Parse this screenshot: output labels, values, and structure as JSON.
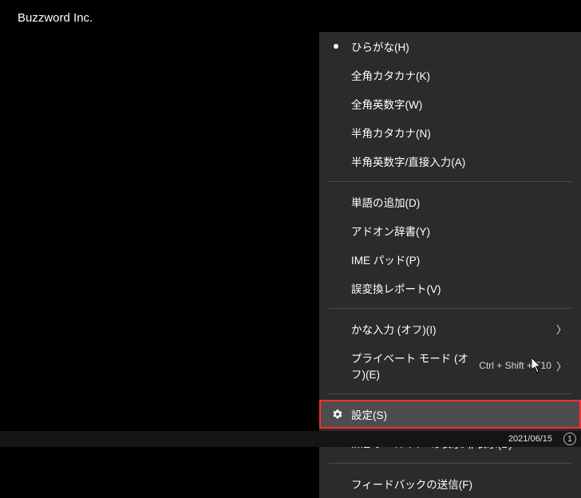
{
  "title": "Buzzword Inc.",
  "menu": {
    "items": [
      {
        "id": "hiragana",
        "label": "ひらがな(H)",
        "selected": true
      },
      {
        "id": "fullkatakana",
        "label": "全角カタカナ(K)"
      },
      {
        "id": "fullalnum",
        "label": "全角英数字(W)"
      },
      {
        "id": "halfkatakana",
        "label": "半角カタカナ(N)"
      },
      {
        "id": "halfalnum",
        "label": "半角英数字/直接入力(A)"
      }
    ],
    "items2": [
      {
        "id": "addword",
        "label": "単語の追加(D)"
      },
      {
        "id": "addondict",
        "label": "アドオン辞書(Y)"
      },
      {
        "id": "imepad",
        "label": "IME パッド(P)"
      },
      {
        "id": "misconv",
        "label": "誤変換レポート(V)"
      }
    ],
    "items3": [
      {
        "id": "kanainput",
        "label": "かな入力 (オフ)(I)",
        "submenu": true
      },
      {
        "id": "privatemode",
        "label": "プライベート モード (オフ)(E)",
        "shortcut": "Ctrl + Shift + F10",
        "submenu": true
      }
    ],
    "items4": [
      {
        "id": "settings",
        "label": "設定(S)",
        "icon": "gear",
        "highlighted": true
      },
      {
        "id": "toolbar",
        "label": "IME ツール バーの表示/非表示(B)"
      }
    ],
    "items5": [
      {
        "id": "feedback",
        "label": "フィードバックの送信(F)"
      }
    ],
    "chevron_glyph": "〉"
  },
  "taskbar": {
    "date": "2021/06/15",
    "badge_text": "1"
  }
}
